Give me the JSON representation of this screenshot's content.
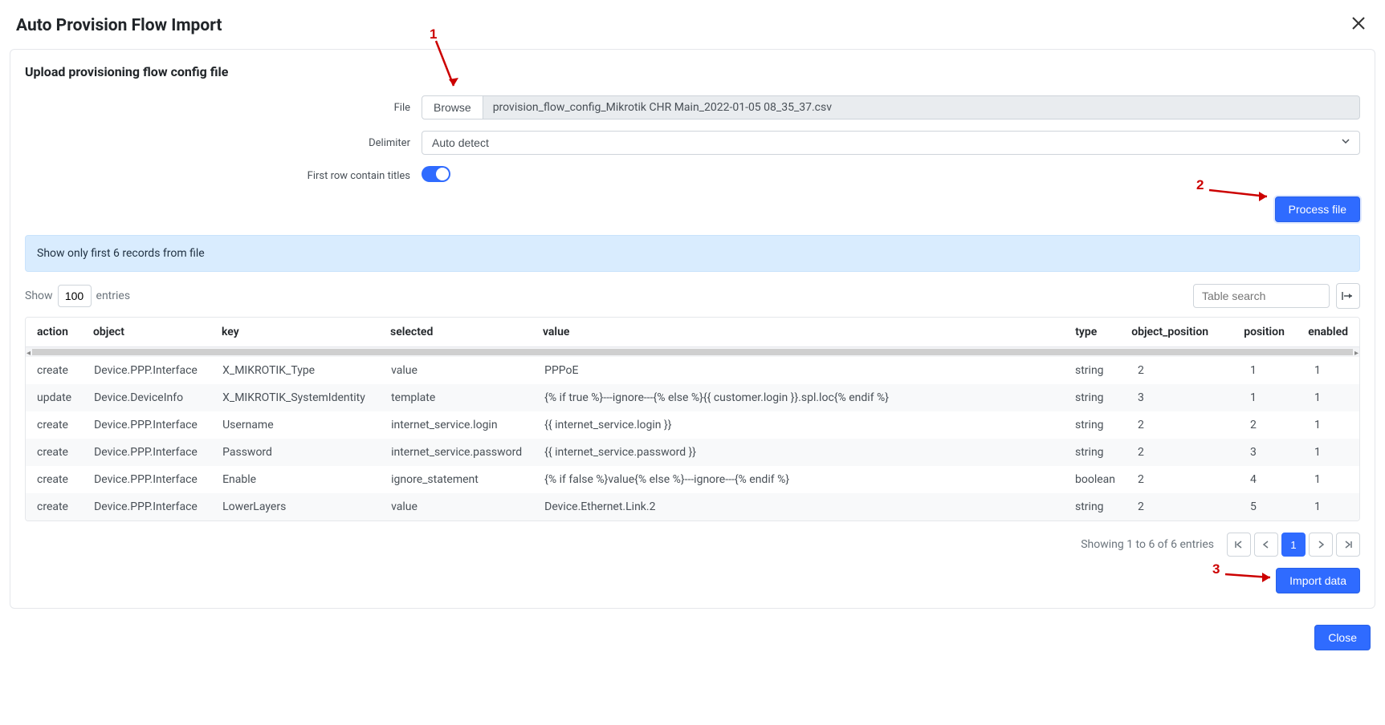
{
  "modal": {
    "title": "Auto Provision Flow Import",
    "panel_title": "Upload provisioning flow config file",
    "file_label": "File",
    "browse_label": "Browse",
    "file_name": "provision_flow_config_Mikrotik CHR Main_2022-01-05 08_35_37.csv",
    "delimiter_label": "Delimiter",
    "delimiter_value": "Auto detect",
    "first_row_label": "First row contain titles",
    "process_button": "Process file",
    "info_banner": "Show only first 6 records from file",
    "show_label": "Show",
    "show_value": "100",
    "entries_label": "entries",
    "search_placeholder": "Table search",
    "columns": [
      "action",
      "object",
      "key",
      "selected",
      "value",
      "type",
      "object_position",
      "position",
      "enabled"
    ],
    "rows": [
      {
        "action": "create",
        "object": "Device.PPP.Interface",
        "key": "X_MIKROTIK_Type",
        "selected": "value",
        "value": "PPPoE",
        "type": "string",
        "object_position": "2",
        "position": "1",
        "enabled": "1"
      },
      {
        "action": "update",
        "object": "Device.DeviceInfo",
        "key": "X_MIKROTIK_SystemIdentity",
        "selected": "template",
        "value": "{% if true %}---ignore---{% else %}{{ customer.login }}.spl.loc{% endif %}",
        "type": "string",
        "object_position": "3",
        "position": "1",
        "enabled": "1"
      },
      {
        "action": "create",
        "object": "Device.PPP.Interface",
        "key": "Username",
        "selected": "internet_service.login",
        "value": "{{ internet_service.login }}",
        "type": "string",
        "object_position": "2",
        "position": "2",
        "enabled": "1"
      },
      {
        "action": "create",
        "object": "Device.PPP.Interface",
        "key": "Password",
        "selected": "internet_service.password",
        "value": "{{ internet_service.password }}",
        "type": "string",
        "object_position": "2",
        "position": "3",
        "enabled": "1"
      },
      {
        "action": "create",
        "object": "Device.PPP.Interface",
        "key": "Enable",
        "selected": "ignore_statement",
        "value": "{% if false %}value{% else %}---ignore---{% endif %}",
        "type": "boolean",
        "object_position": "2",
        "position": "4",
        "enabled": "1"
      },
      {
        "action": "create",
        "object": "Device.PPP.Interface",
        "key": "LowerLayers",
        "selected": "value",
        "value": "Device.Ethernet.Link.2",
        "type": "string",
        "object_position": "2",
        "position": "5",
        "enabled": "1"
      }
    ],
    "page_status": "Showing 1 to 6 of 6 entries",
    "current_page": "1",
    "import_button": "Import data",
    "close_button": "Close"
  },
  "annotations": {
    "one": "1",
    "two": "2",
    "three": "3"
  }
}
